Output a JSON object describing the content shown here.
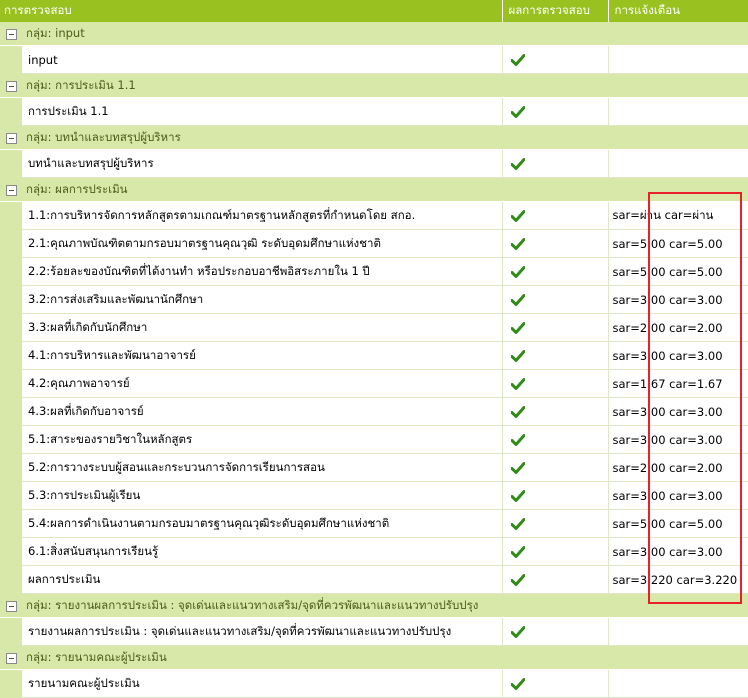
{
  "header": {
    "col_check": "การตรวจสอบ",
    "col_result": "ผลการตรวจสอบ",
    "col_alert": "การแจ้งเตือน"
  },
  "groups": [
    {
      "label": "กลุ่ม: input",
      "items": [
        {
          "name": "input",
          "ok": true,
          "alert": ""
        }
      ]
    },
    {
      "label": "กลุ่ม: การประเมิน 1.1",
      "items": [
        {
          "name": "การประเมิน 1.1",
          "ok": true,
          "alert": ""
        }
      ]
    },
    {
      "label": "กลุ่ม: บทนำและบทสรุปผู้บริหาร",
      "items": [
        {
          "name": "บทนำและบทสรุปผู้บริหาร",
          "ok": true,
          "alert": ""
        }
      ]
    },
    {
      "label": "กลุ่ม: ผลการประเมิน",
      "items": [
        {
          "name": "1.1:การบริหารจัดการหลักสูตรตามเกณฑ์มาตรฐานหลักสูตรที่กำหนดโดย สกอ.",
          "ok": true,
          "alert": "sar=ผ่าน car=ผ่าน"
        },
        {
          "name": "2.1:คุณภาพบัณฑิตตามกรอบมาตรฐานคุณวุฒิ ระดับอุดมศึกษาแห่งชาติ",
          "ok": true,
          "alert": "sar=5.00 car=5.00"
        },
        {
          "name": "2.2:ร้อยละของบัณฑิตที่ได้งานทำ หรือประกอบอาชีพอิสระภายใน 1 ปี",
          "ok": true,
          "alert": "sar=5.00 car=5.00"
        },
        {
          "name": "3.2:การส่งเสริมและพัฒนานักศึกษา",
          "ok": true,
          "alert": "sar=3.00 car=3.00"
        },
        {
          "name": "3.3:ผลที่เกิดกับนักศึกษา",
          "ok": true,
          "alert": "sar=2.00 car=2.00"
        },
        {
          "name": "4.1:การบริหารและพัฒนาอาจารย์",
          "ok": true,
          "alert": "sar=3.00 car=3.00"
        },
        {
          "name": "4.2:คุณภาพอาจารย์",
          "ok": true,
          "alert": "sar=1.67 car=1.67"
        },
        {
          "name": "4.3:ผลที่เกิดกับอาจารย์",
          "ok": true,
          "alert": "sar=3.00 car=3.00"
        },
        {
          "name": "5.1:สาระของรายวิชาในหลักสูตร",
          "ok": true,
          "alert": "sar=3.00 car=3.00"
        },
        {
          "name": "5.2:การวางระบบผู้สอนและกระบวนการจัดการเรียนการสอน",
          "ok": true,
          "alert": "sar=2.00 car=2.00"
        },
        {
          "name": "5.3:การประเมินผู้เรียน",
          "ok": true,
          "alert": "sar=3.00 car=3.00"
        },
        {
          "name": "5.4:ผลการดำเนินงานตามกรอบมาตรฐานคุณวุฒิระดับอุดมศึกษาแห่งชาติ",
          "ok": true,
          "alert": "sar=5.00 car=5.00"
        },
        {
          "name": "6.1:สิ่งสนับสนุนการเรียนรู้",
          "ok": true,
          "alert": "sar=3.00 car=3.00"
        },
        {
          "name": "ผลการประเมิน",
          "ok": true,
          "alert": "sar=3.220 car=3.220"
        }
      ]
    },
    {
      "label": "กลุ่ม: รายงานผลการประเมิน : จุดเด่นและแนวทางเสริม/จุดที่ควรพัฒนาและแนวทางปรับปรุง",
      "items": [
        {
          "name": "รายงานผลการประเมิน : จุดเด่นและแนวทางเสริม/จุดที่ควรพัฒนาและแนวทางปรับปรุง",
          "ok": true,
          "alert": ""
        }
      ]
    },
    {
      "label": "กลุ่ม: รายนามคณะผู้ประเมิน",
      "items": [
        {
          "name": "รายนามคณะผู้ประเมิน",
          "ok": true,
          "alert": ""
        }
      ]
    }
  ],
  "icons": {
    "toggle": "collapse-minus-icon",
    "result": "green-checkmark-icon"
  },
  "colors": {
    "header_bg": "#99c11f",
    "group_bg": "#d8e8a8",
    "check": "#2e8b14",
    "highlight": "#e8202a"
  }
}
